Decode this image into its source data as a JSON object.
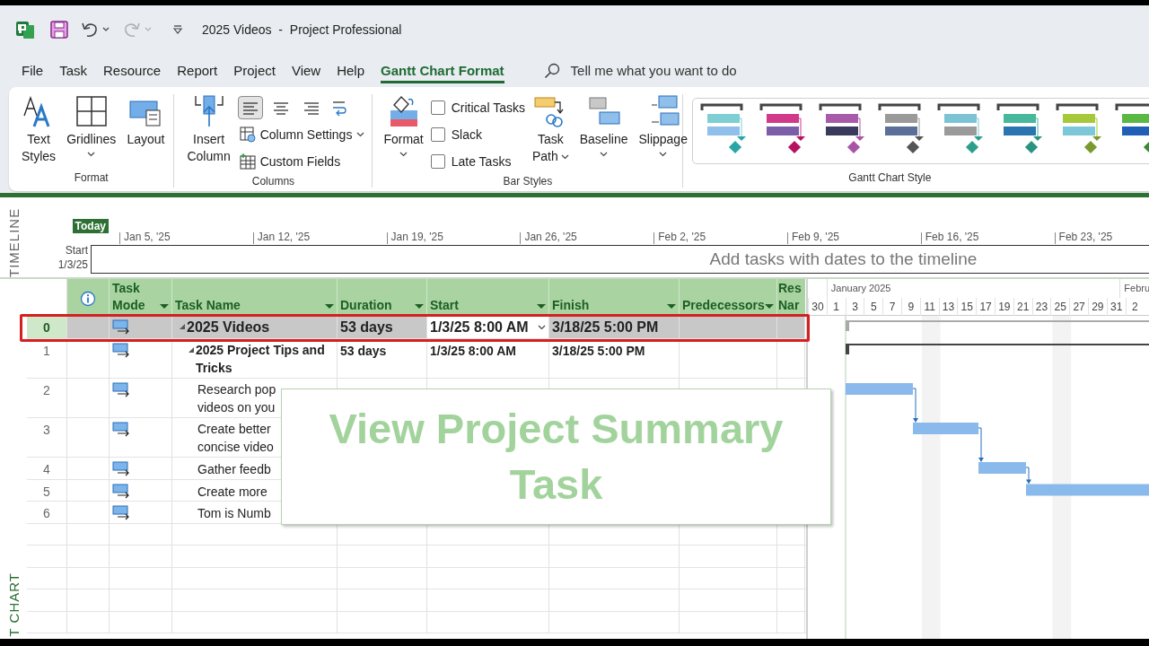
{
  "title_bar": {
    "title": "2025 Videos  -  Project Professional",
    "quick_access": [
      {
        "kind": "logo"
      },
      {
        "kind": "save"
      },
      {
        "kind": "undo",
        "disabled": false
      },
      {
        "kind": "redo",
        "disabled": true
      },
      {
        "kind": "customize"
      }
    ]
  },
  "menu_tabs": [
    {
      "label": "File",
      "selected": false
    },
    {
      "label": "Task",
      "selected": false
    },
    {
      "label": "Resource",
      "selected": false
    },
    {
      "label": "Report",
      "selected": false
    },
    {
      "label": "Project",
      "selected": false
    },
    {
      "label": "View",
      "selected": false
    },
    {
      "label": "Help",
      "selected": false
    },
    {
      "label": "Gantt Chart Format",
      "selected": true
    }
  ],
  "search": {
    "placeholder": "Tell me what you want to do"
  },
  "ribbon": {
    "format_group": {
      "label": "Format",
      "buttons": [
        {
          "lines": [
            "Text",
            "Styles"
          ],
          "dropdown": false
        },
        {
          "lines": [
            "Gridlines"
          ],
          "dropdown": true
        },
        {
          "lines": [
            "Layout"
          ],
          "dropdown": false
        }
      ]
    },
    "columns_group": {
      "label": "Columns",
      "insert": {
        "lines": [
          "Insert",
          "Column"
        ]
      },
      "alignments": [
        {
          "selected": true
        },
        {
          "selected": false
        },
        {
          "selected": false
        }
      ],
      "column_settings": {
        "label": "Column Settings",
        "dropdown": true
      },
      "custom_fields": {
        "label": "Custom Fields"
      }
    },
    "bar_styles_group": {
      "label": "Bar Styles",
      "format": {
        "lines": [
          "Format"
        ],
        "dropdown": true
      },
      "checkboxes": [
        {
          "label": "Critical Tasks",
          "checked": false
        },
        {
          "label": "Slack",
          "checked": false
        },
        {
          "label": "Late Tasks",
          "checked": false
        }
      ],
      "buttons": [
        {
          "lines": [
            "Task",
            "Path"
          ],
          "dropdown": true
        },
        {
          "lines": [
            "Baseline"
          ],
          "dropdown": true
        },
        {
          "lines": [
            "Slippage"
          ],
          "dropdown": true
        }
      ]
    },
    "gantt_style_group": {
      "label": "Gantt Chart Style",
      "styles": [
        {
          "bars": [
            {
              "color": "#7ecfd4"
            },
            {
              "color": "#8fbfea"
            }
          ],
          "milestone": {
            "color": "#2aa5a5"
          }
        },
        {
          "bars": [
            {
              "color": "#d1398a"
            },
            {
              "color": "#7b5ea7"
            }
          ],
          "milestone": {
            "color": "#b5135f"
          }
        },
        {
          "bars": [
            {
              "color": "#a85ba8"
            },
            {
              "color": "#3a3a5c"
            }
          ],
          "milestone": {
            "color": "#a855a8"
          }
        },
        {
          "bars": [
            {
              "color": "#9a9a9a"
            },
            {
              "color": "#5b6f99"
            }
          ],
          "milestone": {
            "color": "#555555"
          }
        },
        {
          "bars": [
            {
              "color": "#7cc3d6"
            },
            {
              "color": "#9a9a9a"
            }
          ],
          "milestone": {
            "color": "#2e9e8c"
          }
        },
        {
          "bars": [
            {
              "color": "#47b89c"
            },
            {
              "color": "#2a74b0"
            }
          ],
          "milestone": {
            "color": "#2a9480"
          }
        },
        {
          "bars": [
            {
              "color": "#a8c83c"
            },
            {
              "color": "#7cc8d8"
            }
          ],
          "milestone": {
            "color": "#7a9a2e"
          }
        },
        {
          "bars": [
            {
              "color": "#5ab845"
            },
            {
              "color": "#1f5fb8"
            }
          ],
          "milestone": {
            "color": "#3a8a30"
          }
        }
      ]
    }
  },
  "timeline": {
    "side_label": "TIMELINE",
    "today": "Today",
    "start_label": "Start",
    "start_date": "1/3/25",
    "ticks": [
      "Jan 5, '25",
      "Jan 12, '25",
      "Jan 19, '25",
      "Jan 26, '25",
      "Feb 2, '25",
      "Feb 9, '25",
      "Feb 16, '25",
      "Feb 23, '25"
    ],
    "placeholder": "Add tasks with dates to the timeline"
  },
  "table": {
    "side_label": "T CHART",
    "columns": [
      {
        "kind": "info"
      },
      {
        "kind": "text",
        "lines": [
          "Task",
          "Mode"
        ],
        "filter": true
      },
      {
        "kind": "text",
        "lines": [
          "Task Name"
        ],
        "filter": true
      },
      {
        "kind": "text",
        "lines": [
          "Duration"
        ],
        "filter": true
      },
      {
        "kind": "text",
        "lines": [
          "Start"
        ],
        "filter": true
      },
      {
        "kind": "text",
        "lines": [
          "Finish"
        ],
        "filter": true
      },
      {
        "kind": "text",
        "lines": [
          "Predecessors"
        ],
        "filter": true
      },
      {
        "kind": "text",
        "lines": [
          "Res",
          "Nar"
        ],
        "filter": false
      }
    ],
    "rows": [
      {
        "id": "0",
        "name_lines": [
          "2025 Videos"
        ],
        "duration": "53 days",
        "start": "1/3/25 8:00 AM",
        "finish": "3/18/25 5:00 PM",
        "selected": true,
        "editing": true,
        "expanded": true,
        "children": [
          {
            "id": "1",
            "name_lines": [
              "2025 Project Tips and",
              "Tricks"
            ],
            "duration": "53 days",
            "start": "1/3/25 8:00 AM",
            "finish": "3/18/25 5:00 PM",
            "selected": false,
            "editing": false,
            "expanded": true,
            "children": [
              {
                "id": "2",
                "name_lines": [
                  "Research pop",
                  "videos on you"
                ],
                "selected": false,
                "editing": false
              },
              {
                "id": "3",
                "name_lines": [
                  "Create better",
                  "concise video"
                ],
                "selected": false,
                "editing": false
              },
              {
                "id": "4",
                "name_lines": [
                  "Gather feedb"
                ],
                "selected": false,
                "editing": false
              },
              {
                "id": "5",
                "name_lines": [
                  "Create more"
                ],
                "selected": false,
                "editing": false
              },
              {
                "id": "6",
                "name_lines": [
                  "Tom is Numb"
                ],
                "selected": false,
                "editing": false
              }
            ]
          }
        ]
      }
    ]
  },
  "gantt": {
    "months": [
      "January 2025",
      "Febru"
    ],
    "days": [
      {
        "label": "30",
        "shaded": false
      },
      {
        "label": "1",
        "shaded": false
      },
      {
        "label": "3",
        "shaded": false
      },
      {
        "label": "5",
        "shaded": false
      },
      {
        "label": "7",
        "shaded": false
      },
      {
        "label": "9",
        "shaded": false
      },
      {
        "label": "11",
        "shaded": true
      },
      {
        "label": "13",
        "shaded": false
      },
      {
        "label": "15",
        "shaded": false
      },
      {
        "label": "17",
        "shaded": false
      },
      {
        "label": "19",
        "shaded": false
      },
      {
        "label": "21",
        "shaded": false
      },
      {
        "label": "23",
        "shaded": false
      },
      {
        "label": "25",
        "shaded": true
      },
      {
        "label": "27",
        "shaded": false
      },
      {
        "label": "29",
        "shaded": false
      },
      {
        "label": "31",
        "shaded": false
      },
      {
        "label": "2",
        "shaded": false
      }
    ]
  },
  "callout": {
    "text": "View Project Summary Task"
  }
}
